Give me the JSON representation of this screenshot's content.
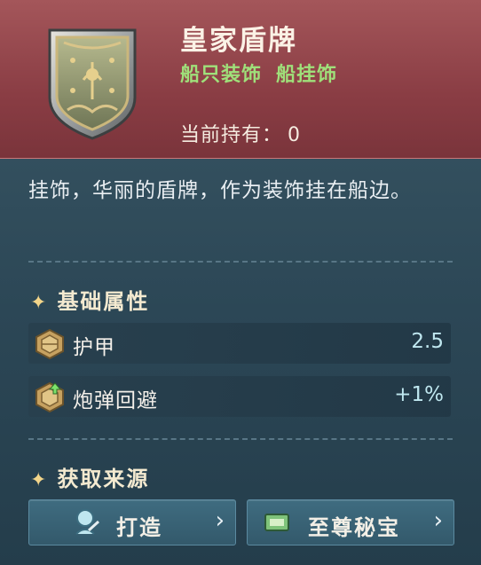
{
  "item": {
    "title": "皇家盾牌",
    "tags": [
      "船只装饰",
      "船挂饰"
    ],
    "owned_label": "当前持有：",
    "owned_value": "0",
    "icon": "royal-shield-icon"
  },
  "description": "挂饰，华丽的盾牌，作为装饰挂在船边。",
  "base_attributes": {
    "title": "基础属性",
    "star_icon": "star-icon",
    "items": [
      {
        "name": "护甲",
        "value": "2.5",
        "icon": "armor-plate-icon"
      },
      {
        "name": "炮弹回避",
        "value": "+1%",
        "icon": "evasion-plate-icon"
      }
    ]
  },
  "sources": {
    "title": "获取来源",
    "star_icon": "star-icon",
    "buttons": [
      {
        "label": "打造",
        "icon": "craft-icon",
        "chevron": "›"
      },
      {
        "label": "至尊秘宝",
        "icon": "ticket-icon",
        "chevron": "›"
      }
    ]
  },
  "colors": {
    "header_bg": "#8a3d44",
    "tag_green": "#9fe07a",
    "panel_bg": "#2c4756",
    "value_cyan": "#bfe7ef"
  }
}
